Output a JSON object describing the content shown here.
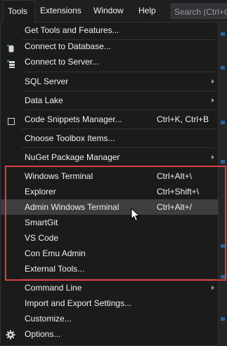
{
  "menubar": {
    "items": [
      "Tools",
      "Extensions",
      "Window",
      "Help"
    ],
    "search_text": "Search (Ctrl+Q)"
  },
  "menu": {
    "items": [
      {
        "label": "Get Tools and Features...",
        "shortcut": "",
        "icon": ""
      },
      {
        "label": "Connect to Database...",
        "shortcut": "",
        "icon": "database-connect-icon"
      },
      {
        "label": "Connect to Server...",
        "shortcut": "",
        "icon": "server-connect-icon"
      },
      {
        "label": "SQL Server",
        "shortcut": "",
        "submenu": true
      },
      {
        "label": "Data Lake",
        "shortcut": "",
        "submenu": true
      },
      {
        "label": "Code Snippets Manager...",
        "shortcut": "Ctrl+K, Ctrl+B",
        "icon": "snippet-icon"
      },
      {
        "label": "Choose Toolbox Items...",
        "shortcut": ""
      },
      {
        "label": "NuGet Package Manager",
        "shortcut": "",
        "submenu": true
      },
      {
        "label": "Windows Terminal",
        "shortcut": "Ctrl+Alt+\\"
      },
      {
        "label": "Explorer",
        "shortcut": "Ctrl+Shift+\\"
      },
      {
        "label": "Admin Windows Terminal",
        "shortcut": "Ctrl+Alt+/"
      },
      {
        "label": "SmartGit",
        "shortcut": ""
      },
      {
        "label": "VS Code",
        "shortcut": ""
      },
      {
        "label": "Con Emu Admin",
        "shortcut": ""
      },
      {
        "label": "External Tools...",
        "shortcut": ""
      },
      {
        "label": "Command Line",
        "shortcut": "",
        "submenu": true
      },
      {
        "label": "Import and Export Settings...",
        "shortcut": ""
      },
      {
        "label": "Customize...",
        "shortcut": ""
      },
      {
        "label": "Options...",
        "shortcut": "",
        "icon": "gear-icon"
      }
    ]
  },
  "colors": {
    "highlight_border": "#d9413b",
    "hover_row": "#3e3e40",
    "menu_bg": "#1b1b1c"
  }
}
